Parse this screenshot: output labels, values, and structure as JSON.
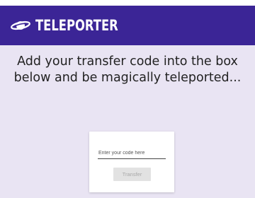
{
  "header": {
    "brand": "TELEPORTER",
    "logo_icon": "planet-icon",
    "background": "#3b2596"
  },
  "main": {
    "headline_line1": "Add your transfer code into the box",
    "headline_line2": "below and be magically teleported...",
    "background": "#e9e4f3"
  },
  "form": {
    "code_placeholder": "Enter your code here",
    "code_value": "",
    "transfer_label": "Transfer",
    "transfer_disabled": true
  }
}
